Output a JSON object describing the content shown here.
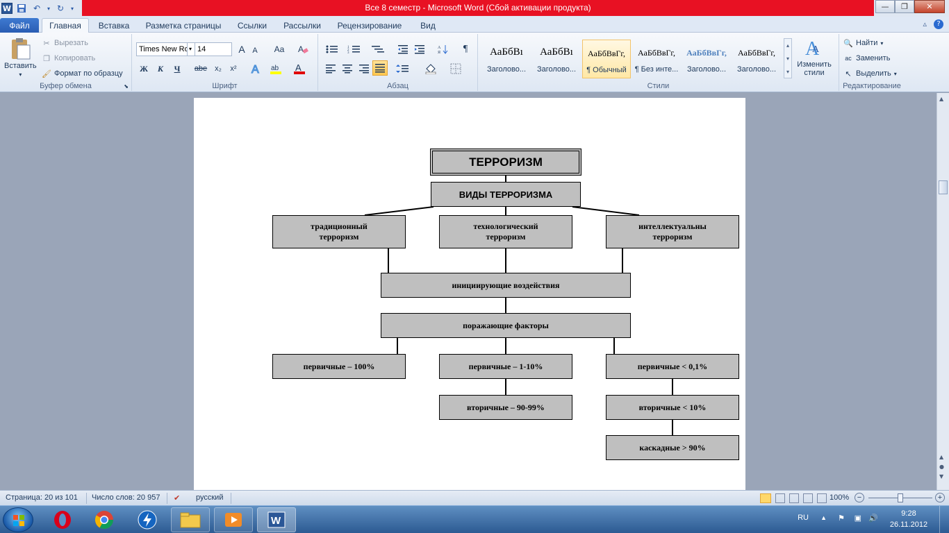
{
  "window": {
    "title": "Все 8 семестр  -  Microsoft Word (Сбой активации продукта)"
  },
  "tabs": [
    "Файл",
    "Главная",
    "Вставка",
    "Разметка страницы",
    "Ссылки",
    "Рассылки",
    "Рецензирование",
    "Вид"
  ],
  "ribbon": {
    "clipboard": {
      "label": "Буфер обмена",
      "paste": "Вставить",
      "cut": "Вырезать",
      "copy": "Копировать",
      "format_painter": "Формат по образцу"
    },
    "font": {
      "label": "Шрифт",
      "name": "Times New Ro",
      "size": "14",
      "bold": "Ж",
      "italic": "К",
      "underline": "Ч",
      "strike": "abe",
      "subscript": "x₂",
      "superscript": "x²",
      "grow": "A",
      "shrink": "A",
      "case": "Aa"
    },
    "paragraph": {
      "label": "Абзац",
      "pilcrow": "¶"
    },
    "styles": {
      "label": "Стили",
      "items": [
        {
          "sample": "АаБбВı",
          "name": "Заголово..."
        },
        {
          "sample": "АаБбВı",
          "name": "Заголово..."
        },
        {
          "sample": "АаБбВвГг,",
          "name": "¶ Обычный"
        },
        {
          "sample": "АаБбВвГг,",
          "name": "¶ Без инте..."
        },
        {
          "sample": "АаБбВвГг,",
          "name": "Заголово..."
        },
        {
          "sample": "АаБбВвГг,",
          "name": "Заголово..."
        }
      ],
      "change": "Изменить стили"
    },
    "editing": {
      "label": "Редактирование",
      "find": "Найти",
      "replace": "Заменить",
      "select": "Выделить"
    }
  },
  "diagram": {
    "title": "ТЕРРОРИЗМ",
    "types_header": "ВИДЫ   ТЕРРОРИЗМА",
    "types": [
      "традиционный терроризм",
      "технологический терроризм",
      "интеллектуальны терроризм"
    ],
    "initiating": "инициирующие воздействия",
    "damaging": "поражающие факторы",
    "col1": [
      "первичные – 100%"
    ],
    "col2": [
      "первичные – 1-10%",
      "вторичные – 90-99%"
    ],
    "col3": [
      "первичные < 0,1%",
      "вторичные < 10%",
      "каскадные > 90%"
    ]
  },
  "statusbar": {
    "page": "Страница: 20 из 101",
    "words": "Число слов: 20 957",
    "language": "русский",
    "zoom": "100%"
  },
  "taskbar": {
    "lang": "RU",
    "time": "9:28",
    "date": "26.11.2012"
  },
  "colors": {
    "title_bar_error": "#e81123",
    "box_fill": "#bfbfbf",
    "file_tab": "#2a5db3"
  }
}
